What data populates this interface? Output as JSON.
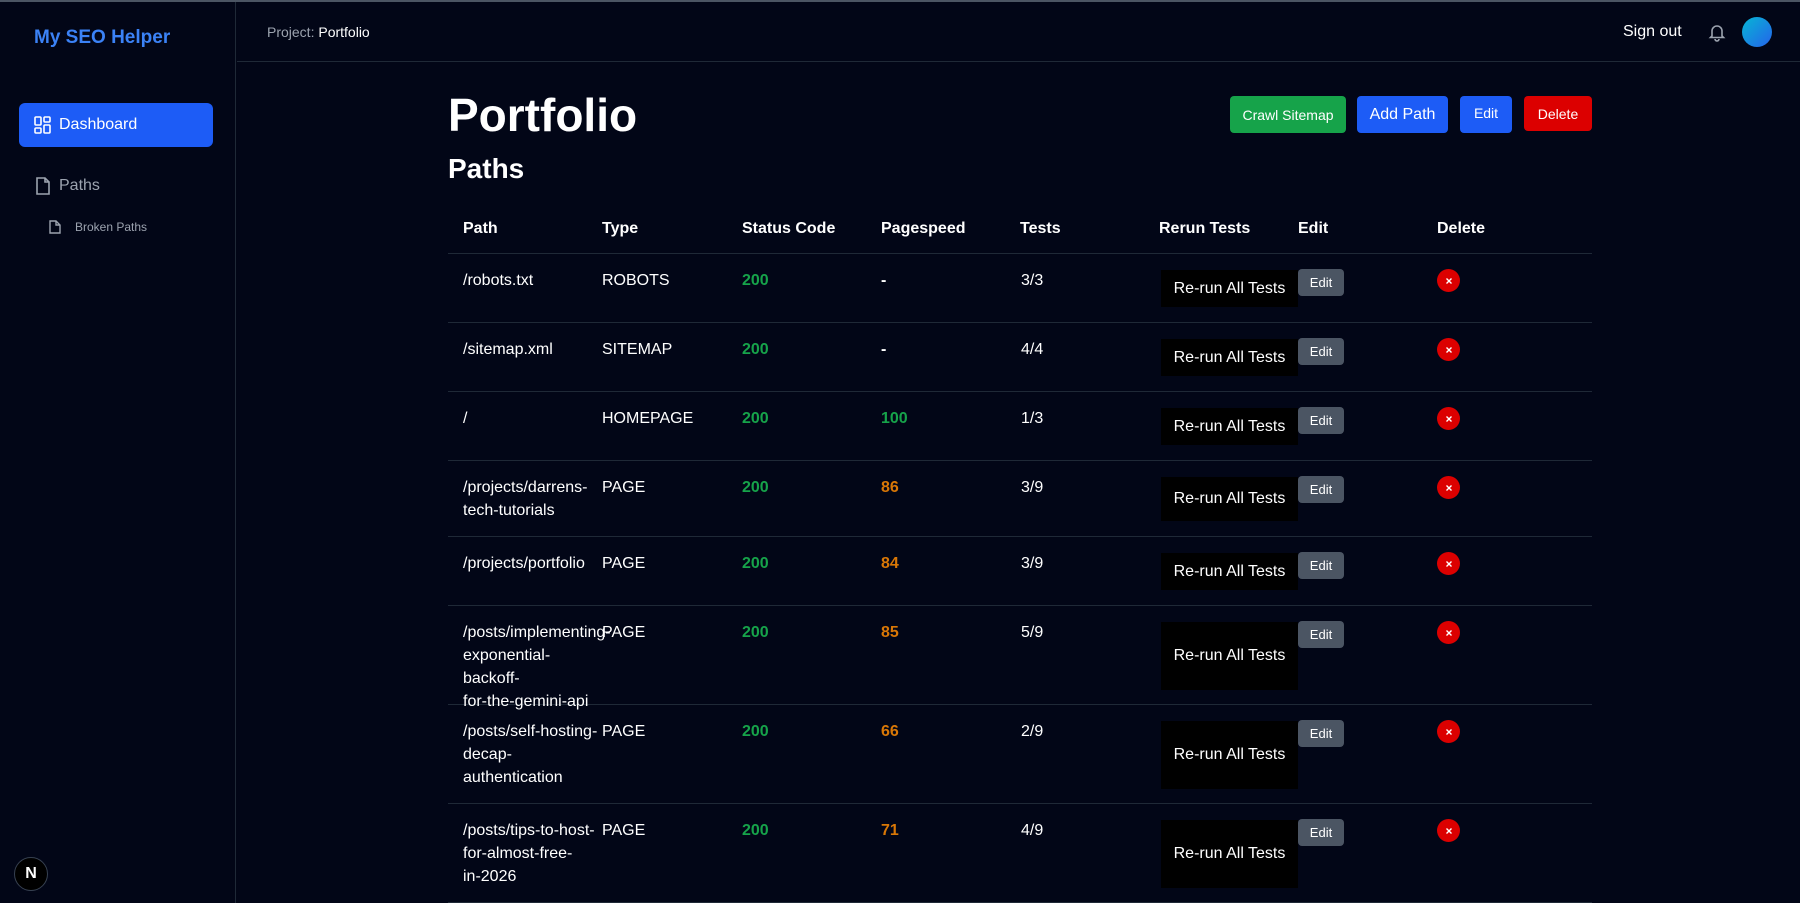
{
  "app": {
    "brand": "My SEO Helper"
  },
  "sidebar": {
    "items": [
      {
        "label": "Dashboard",
        "icon": "dashboard-icon",
        "active": true
      },
      {
        "label": "Paths",
        "icon": "file-icon",
        "active": false
      }
    ],
    "sub_items": [
      {
        "label": "Broken Paths",
        "icon": "file-icon"
      }
    ],
    "badge": "N"
  },
  "header": {
    "breadcrumb_label": "Project: ",
    "breadcrumb_value": "Portfolio",
    "signout": "Sign out",
    "bell_icon": "bell-icon",
    "avatar": "avatar"
  },
  "main": {
    "title": "Portfolio",
    "section_title": "Paths",
    "actions": {
      "crawl": "Crawl Sitemap",
      "add": "Add Path",
      "edit": "Edit",
      "delete": "Delete"
    },
    "table": {
      "columns": [
        "Path",
        "Type",
        "Status Code",
        "Pagespeed",
        "Tests",
        "Rerun Tests",
        "Edit",
        "Delete"
      ],
      "rows": [
        {
          "path": "/robots.txt",
          "type": "ROBOTS",
          "status": "200",
          "pagespeed": "-",
          "tests": "3/3",
          "rerun": "Re-run All Tests",
          "edit": "Edit"
        },
        {
          "path": "/sitemap.xml",
          "type": "SITEMAP",
          "status": "200",
          "pagespeed": "-",
          "tests": "4/4",
          "rerun": "Re-run All Tests",
          "edit": "Edit"
        },
        {
          "path": "/",
          "type": "HOMEPAGE",
          "status": "200",
          "pagespeed": "100",
          "tests": "1/3",
          "rerun": "Re-run All Tests",
          "edit": "Edit"
        },
        {
          "path": "/projects/darrens-tech-tutorials",
          "type": "PAGE",
          "status": "200",
          "pagespeed": "86",
          "tests": "3/9",
          "rerun": "Re-run All Tests",
          "edit": "Edit"
        },
        {
          "path": "/projects/portfolio",
          "type": "PAGE",
          "status": "200",
          "pagespeed": "84",
          "tests": "3/9",
          "rerun": "Re-run All Tests",
          "edit": "Edit"
        },
        {
          "path": "/posts/implementing-exponential-backoff-for-the-gemini-api",
          "type": "PAGE",
          "status": "200",
          "pagespeed": "85",
          "tests": "5/9",
          "rerun": "Re-run All Tests",
          "edit": "Edit"
        },
        {
          "path": "/posts/self-hosting-decap-authentication",
          "type": "PAGE",
          "status": "200",
          "pagespeed": "66",
          "tests": "2/9",
          "rerun": "Re-run All Tests",
          "edit": "Edit"
        },
        {
          "path": "/posts/tips-to-host-for-almost-free-in-2026",
          "type": "PAGE",
          "status": "200",
          "pagespeed": "71",
          "tests": "4/9",
          "rerun": "Re-run All Tests",
          "edit": "Edit"
        }
      ]
    }
  },
  "colors": {
    "background": "#020617",
    "brand": "#3b82f6",
    "primary": "#1d5cf6",
    "success": "#16a34a",
    "warning": "#d97706",
    "danger": "#dc0000",
    "muted": "#9ca3af"
  }
}
